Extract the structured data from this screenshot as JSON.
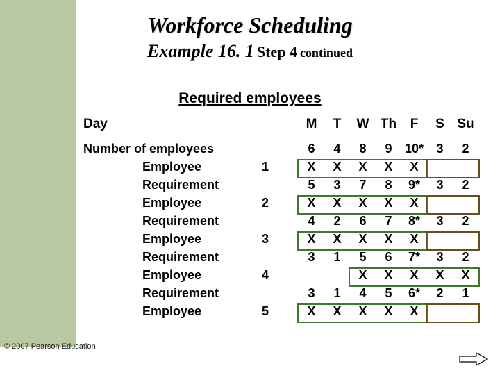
{
  "title": "Workforce Scheduling",
  "subtitle": {
    "example": "Example 16. 1",
    "step": "Step 4",
    "cont": "continued"
  },
  "section_label": "Required employees",
  "day_label": "Day",
  "day_headers": [
    "M",
    "T",
    "W",
    "Th",
    "F",
    "S",
    "Su"
  ],
  "row_labels": {
    "number_of_employees": "Number of employees",
    "employee": "Employee",
    "requirement": "Requirement"
  },
  "rows": [
    {
      "label_key": "number_of_employees",
      "cells": [
        "6",
        "4",
        "8",
        "9",
        "10*",
        "3",
        "2"
      ]
    },
    {
      "label_key": "employee",
      "num": "1",
      "cells": [
        "X",
        "X",
        "X",
        "X",
        "X",
        "",
        ""
      ]
    },
    {
      "label_key": "requirement",
      "cells": [
        "5",
        "3",
        "7",
        "8",
        "9*",
        "3",
        "2"
      ]
    },
    {
      "label_key": "employee",
      "num": "2",
      "cells": [
        "X",
        "X",
        "X",
        "X",
        "X",
        "",
        ""
      ]
    },
    {
      "label_key": "requirement",
      "cells": [
        "4",
        "2",
        "6",
        "7",
        "8*",
        "3",
        "2"
      ]
    },
    {
      "label_key": "employee",
      "num": "3",
      "cells": [
        "X",
        "X",
        "X",
        "X",
        "X",
        "",
        ""
      ]
    },
    {
      "label_key": "requirement",
      "cells": [
        "3",
        "1",
        "5",
        "6",
        "7*",
        "3",
        "2"
      ]
    },
    {
      "label_key": "employee",
      "num": "4",
      "cells": [
        "",
        "",
        "X",
        "X",
        "X",
        "X",
        "X"
      ]
    },
    {
      "label_key": "requirement",
      "cells": [
        "3",
        "1",
        "4",
        "5",
        "6*",
        "2",
        "1"
      ]
    },
    {
      "label_key": "employee",
      "num": "5",
      "cells": [
        "X",
        "X",
        "X",
        "X",
        "X",
        "",
        ""
      ]
    }
  ],
  "highlights": [
    {
      "type": "five",
      "row": 1
    },
    {
      "type": "two",
      "row": 1
    },
    {
      "type": "five",
      "row": 3
    },
    {
      "type": "two",
      "row": 3
    },
    {
      "type": "five",
      "row": 5
    },
    {
      "type": "two",
      "row": 5
    },
    {
      "type": "fiveShift",
      "row": 7
    },
    {
      "type": "five",
      "row": 9
    },
    {
      "type": "two",
      "row": 9
    }
  ],
  "copyright": "© 2007 Pearson Education"
}
